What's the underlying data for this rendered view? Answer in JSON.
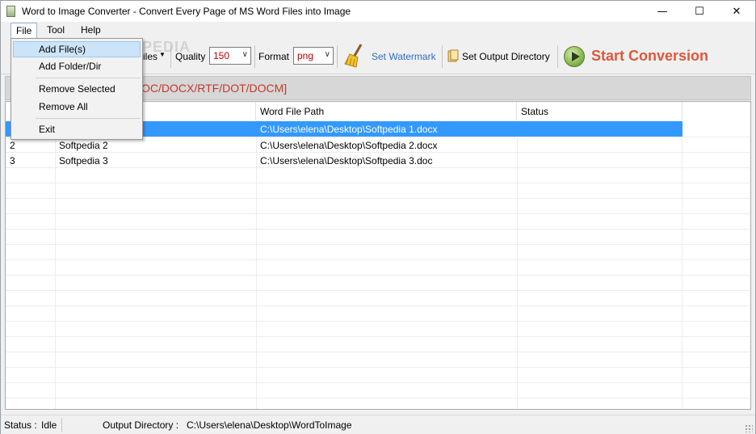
{
  "window": {
    "title": "Word to Image Converter - Convert Every Page of MS Word Files into Image",
    "minimize": "—",
    "maximize": "☐",
    "close": "✕"
  },
  "menu": {
    "file": "File",
    "tool": "Tool",
    "help": "Help"
  },
  "file_menu": {
    "items": [
      {
        "label": "Add File(s)"
      },
      {
        "label": "Add Folder/Dir"
      },
      {
        "label": "Remove Selected"
      },
      {
        "label": "Remove All"
      },
      {
        "label": "Exit"
      }
    ]
  },
  "toolbar": {
    "files_partial": "iles",
    "quality_label": "Quality",
    "quality_value": "150",
    "format_label": "Format",
    "format_value": "png",
    "set_watermark": "Set Watermark",
    "set_output_directory": "Set Output Directory",
    "start_conversion": "Start Conversion"
  },
  "filter": {
    "text": "OC/DOCX/RTF/DOT/DOCM]"
  },
  "grid": {
    "columns": [
      "",
      "",
      "Word File Path",
      "Status"
    ],
    "rows": [
      {
        "num": "",
        "name": "",
        "path": "C:\\Users\\elena\\Desktop\\Softpedia 1.docx",
        "status": ""
      },
      {
        "num": "2",
        "name": "Softpedia 2",
        "path": "C:\\Users\\elena\\Desktop\\Softpedia 2.docx",
        "status": ""
      },
      {
        "num": "3",
        "name": "Softpedia 3",
        "path": "C:\\Users\\elena\\Desktop\\Softpedia 3.doc",
        "status": ""
      }
    ]
  },
  "statusbar": {
    "status_label": "Status :",
    "status_value": "Idle",
    "output_label": "Output Directory :",
    "output_value": "C:\\Users\\elena\\Desktop\\WordToImage"
  },
  "watermark": "SOFTPEDIA",
  "colors": {
    "selection": "#3399ff",
    "start_conversion": "#e0563a",
    "link": "#2f6fc2",
    "filter_text": "#c0392b"
  }
}
